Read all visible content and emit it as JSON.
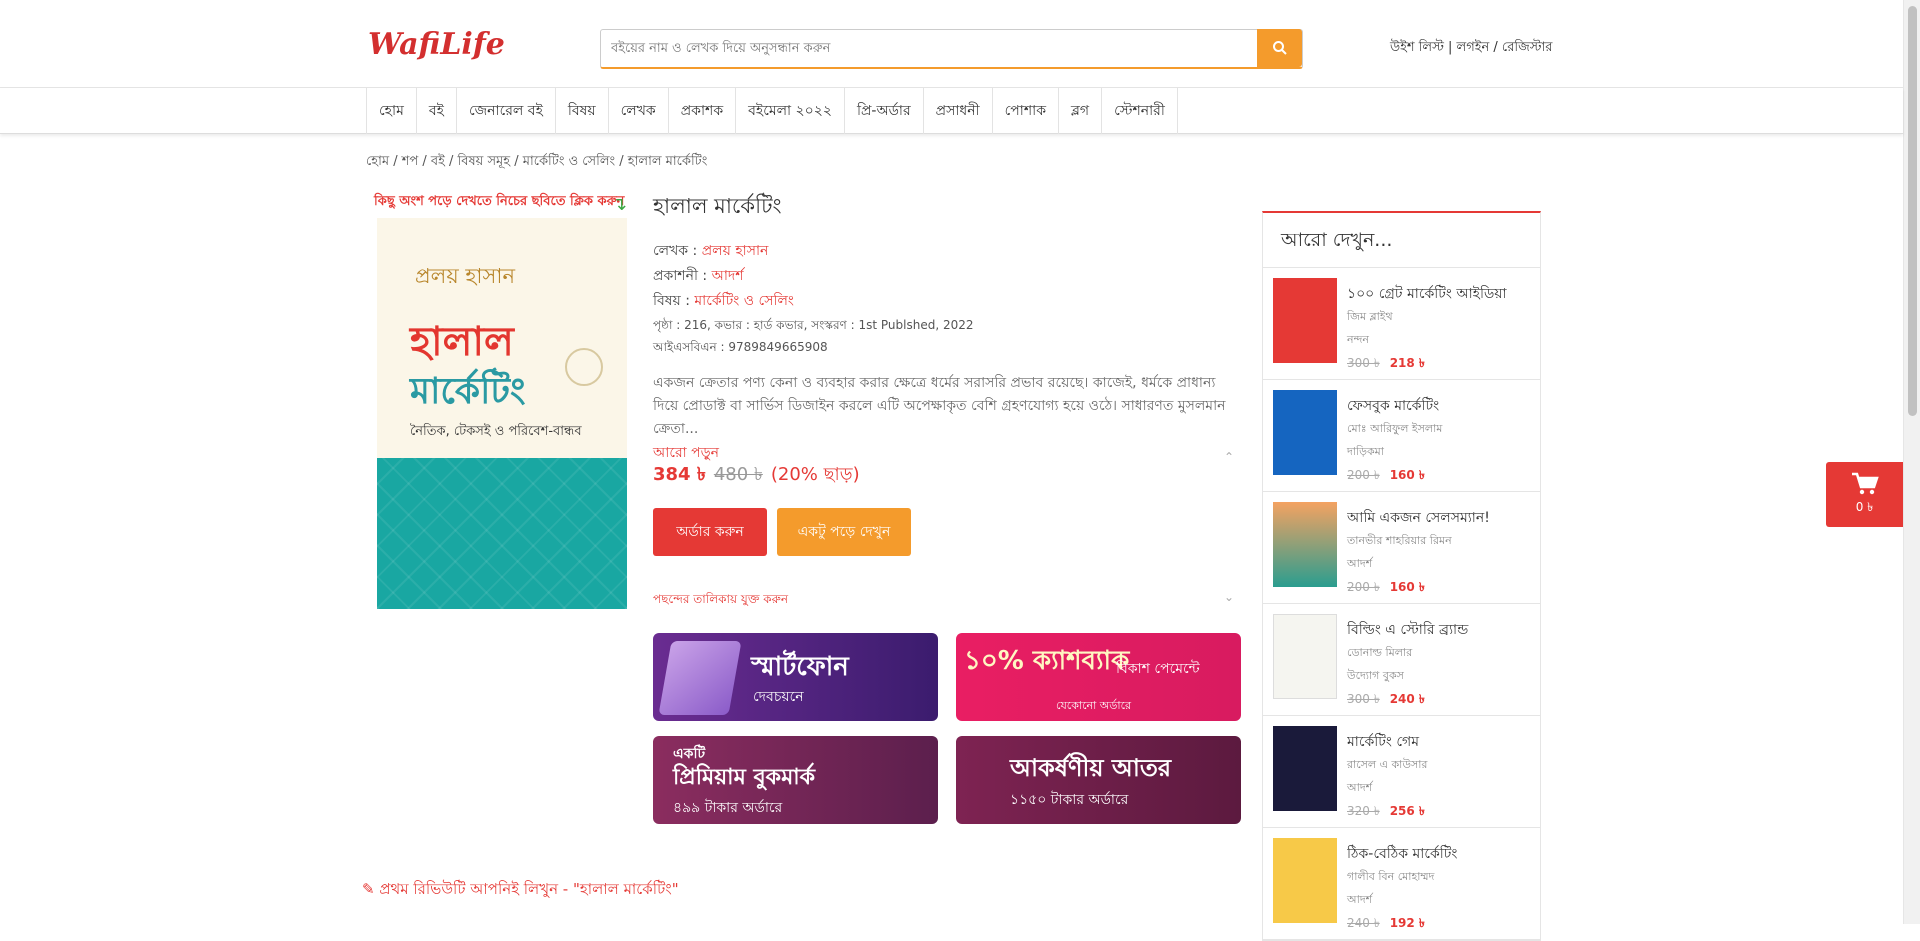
{
  "header": {
    "logo_text": "WafiLife",
    "search_placeholder": "বইয়ের নাম ও লেখক দিয়ে অনুসন্ধান করুন",
    "user_links": "উইশ লিস্ট | লগইন / রেজিস্টার",
    "accent_color": "#f49b2c",
    "brand_color": "#e53935"
  },
  "nav": {
    "items": [
      "হোম",
      "বই",
      "জেনারেল বই",
      "বিষয়",
      "লেখক",
      "প্রকাশক",
      "বইমেলা ২০২২",
      "প্রি-অর্ডার",
      "প্রসাধনী",
      "পোশাক",
      "ব্লগ",
      "স্টেশনারী"
    ]
  },
  "breadcrumb": "হোম / শপ / বই / বিষয় সমূহ / মার্কেটিং ও সেলিং / হালাল মার্কেটিং",
  "preview_hint": "কিছু অংশ পড়ে দেখতে নিচের ছবিতে ক্লিক করুন",
  "cover": {
    "author": "প্রলয় হাসান",
    "title_line1": "হালাল",
    "title_line2": "মার্কেটিং",
    "subtitle": "নৈতিক, টেকসই ও পরিবেশ-বান্ধব"
  },
  "product": {
    "title": "হালাল মার্কেটিং",
    "author_label": "লেখক :",
    "author": "প্রলয় হাসান",
    "publisher_label": "প্রকাশনী :",
    "publisher": "আদর্শ",
    "subject_label": "বিষয় :",
    "subject": "মার্কেটিং ও সেলিং",
    "details": "পৃষ্ঠা : 216, কভার : হার্ড কভার, সংস্করণ : 1st Publshed, 2022",
    "isbn": "আইএসবিএন : 9789849665908",
    "description": "একজন ক্রেতার পণ্য কেনা ও ব্যবহার করার ক্ষেত্রে ধর্মের সরাসরি প্রভাব রয়েছে। কাজেই, ধর্মকে প্রাধান্য দিয়ে প্রোডাক্ট বা সার্ভিস ডিজাইন করলে এটি অপেক্ষাকৃত বেশি গ্রহণযোগ্য হয়ে ওঠে। সাধারণত মুসলমান ক্রেতা...",
    "read_more": "আরো পড়ুন",
    "price": "384 ৳",
    "old_price": "480 ৳",
    "discount": "(20% ছাড়)",
    "order_button": "অর্ডার করুন",
    "read_button": "একটু পড়ে দেখুন",
    "wishlist": "পছন্দের তালিকায় যুক্ত করুন"
  },
  "banners": [
    {
      "title": "স্মার্টফোন",
      "sub": "দেবচয়নে"
    },
    {
      "title": "১০% ক্যাশব্যাক",
      "sub": "বিকাশ পেমেন্টে",
      "note": "যেকোনো অর্ডারে"
    },
    {
      "title": "প্রিমিয়াম বুকমার্ক",
      "pre": "একটি",
      "sub": "৪৯৯ টাকার অর্ডারে"
    },
    {
      "title": "আকর্ষণীয় আতর",
      "sub": "১১৫০ টাকার অর্ডারে"
    }
  ],
  "review_prompt": "প্রথম রিভিউটি আপনিই লিখুন - \"হালাল মার্কেটিং\"",
  "sidebar": {
    "heading": "আরো দেখুন...",
    "items": [
      {
        "title": "১০০ গ্রেট মার্কেটিং আইডিয়া",
        "author": "জিম ব্লাইথ",
        "publisher": "নন্দন",
        "old_price": "300 ৳",
        "price": "218 ৳",
        "thumb_color": "#e53935"
      },
      {
        "title": "ফেসবুক মার্কেটিং",
        "author": "মোঃ আরিফুল ইসলাম",
        "publisher": "দাড়িকমা",
        "old_price": "200 ৳",
        "price": "160 ৳",
        "thumb_color": "#1565c0"
      },
      {
        "title": "আমি একজন সেলসম্যান!",
        "author": "তানভীর শাহরিয়ার রিমন",
        "publisher": "আদর্শ",
        "old_price": "200 ৳",
        "price": "160 ৳",
        "thumb_color": "#f4a261"
      },
      {
        "title": "বিল্ডিং এ স্টোরি ব্র্যান্ড",
        "author": "ডোনাল্ড মিলার",
        "publisher": "উদ্যোগ বুকস",
        "old_price": "300 ৳",
        "price": "240 ৳",
        "thumb_color": "#f5f5f0"
      },
      {
        "title": "মার্কেটিং গেম",
        "author": "রাসেল এ কাউসার",
        "publisher": "আদর্শ",
        "old_price": "320 ৳",
        "price": "256 ৳",
        "thumb_color": "#1a1a3a"
      },
      {
        "title": "ঠিক-বেঠিক মার্কেটিং",
        "author": "গালীব বিন মোহাম্মদ",
        "publisher": "আদর্শ",
        "old_price": "240 ৳",
        "price": "192 ৳",
        "thumb_color": "#f7c948"
      }
    ]
  },
  "cart": {
    "count": "0 ৳"
  }
}
